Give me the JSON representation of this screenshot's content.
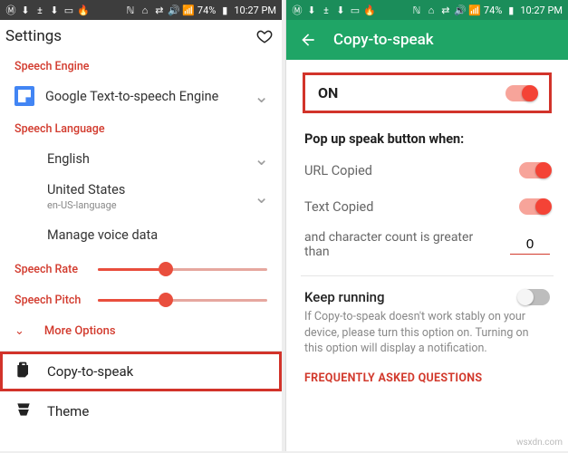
{
  "status": {
    "left_icons": [
      "M",
      "↓",
      "±",
      "↓",
      "□",
      "🔥"
    ],
    "right_icons": [
      "N",
      "⌂",
      "⇄",
      "🔊"
    ],
    "signal": "▲",
    "battery_pct": "74%",
    "time": "10:27 PM"
  },
  "left": {
    "header": {
      "title": "Settings",
      "fav_icon": "heart-outline"
    },
    "engine": {
      "title": "Speech Engine",
      "selected": "Google Text-to-speech Engine"
    },
    "language": {
      "title": "Speech Language",
      "lang": "English",
      "region": "United States",
      "region_sub": "en-US-language",
      "manage": "Manage voice data"
    },
    "rate": {
      "label": "Speech Rate",
      "pct": 40
    },
    "pitch": {
      "label": "Speech Pitch",
      "pct": 40
    },
    "more": "More Options",
    "menu": {
      "copy": "Copy-to-speak",
      "theme": "Theme"
    }
  },
  "right": {
    "appbar": {
      "title": "Copy-to-speak"
    },
    "master": {
      "label": "ON",
      "on": true
    },
    "popup": {
      "title": "Pop up speak button when:",
      "url": {
        "label": "URL Copied",
        "on": true
      },
      "text": {
        "label": "Text Copied",
        "on": true
      },
      "char_prefix": "and character count is greater than",
      "char_value": "0"
    },
    "keep": {
      "title": "Keep running",
      "on": false,
      "desc": "If Copy-to-speak doesn't work stably on your device, please turn this option on.\nTurning on this option will display a notification."
    },
    "faq": "FREQUENTLY ASKED QUESTIONS"
  },
  "watermark": "wsxdn.com"
}
